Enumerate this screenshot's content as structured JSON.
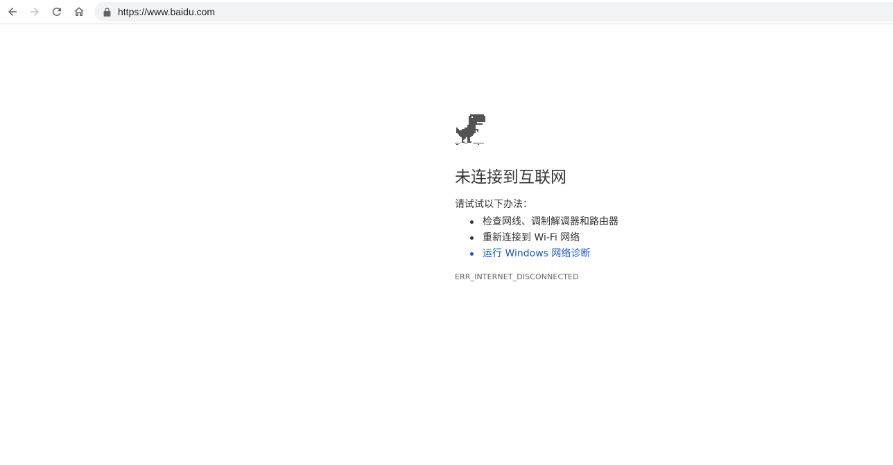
{
  "toolbar": {
    "icons": {
      "back": "arrow-left-icon",
      "forward": "arrow-right-icon",
      "reload": "reload-icon",
      "home": "home-icon",
      "lock": "lock-icon"
    },
    "url": "https://www.baidu.com"
  },
  "error_page": {
    "icon": "offline-dinosaur-icon",
    "heading": "未连接到互联网",
    "subtitle": "请试试以下办法：",
    "suggestions": [
      "检查网线、调制解调器和路由器",
      "重新连接到 Wi-Fi 网络",
      "运行 Windows 网络诊断"
    ],
    "error_code": "ERR_INTERNET_DISCONNECTED"
  },
  "colors": {
    "text": "#333333",
    "link": "#1a57c9",
    "omnibox_bg": "#f1f3f4",
    "icon": "#5f6368",
    "icon_disabled": "#bdc1c6",
    "error_code": "#646464"
  }
}
